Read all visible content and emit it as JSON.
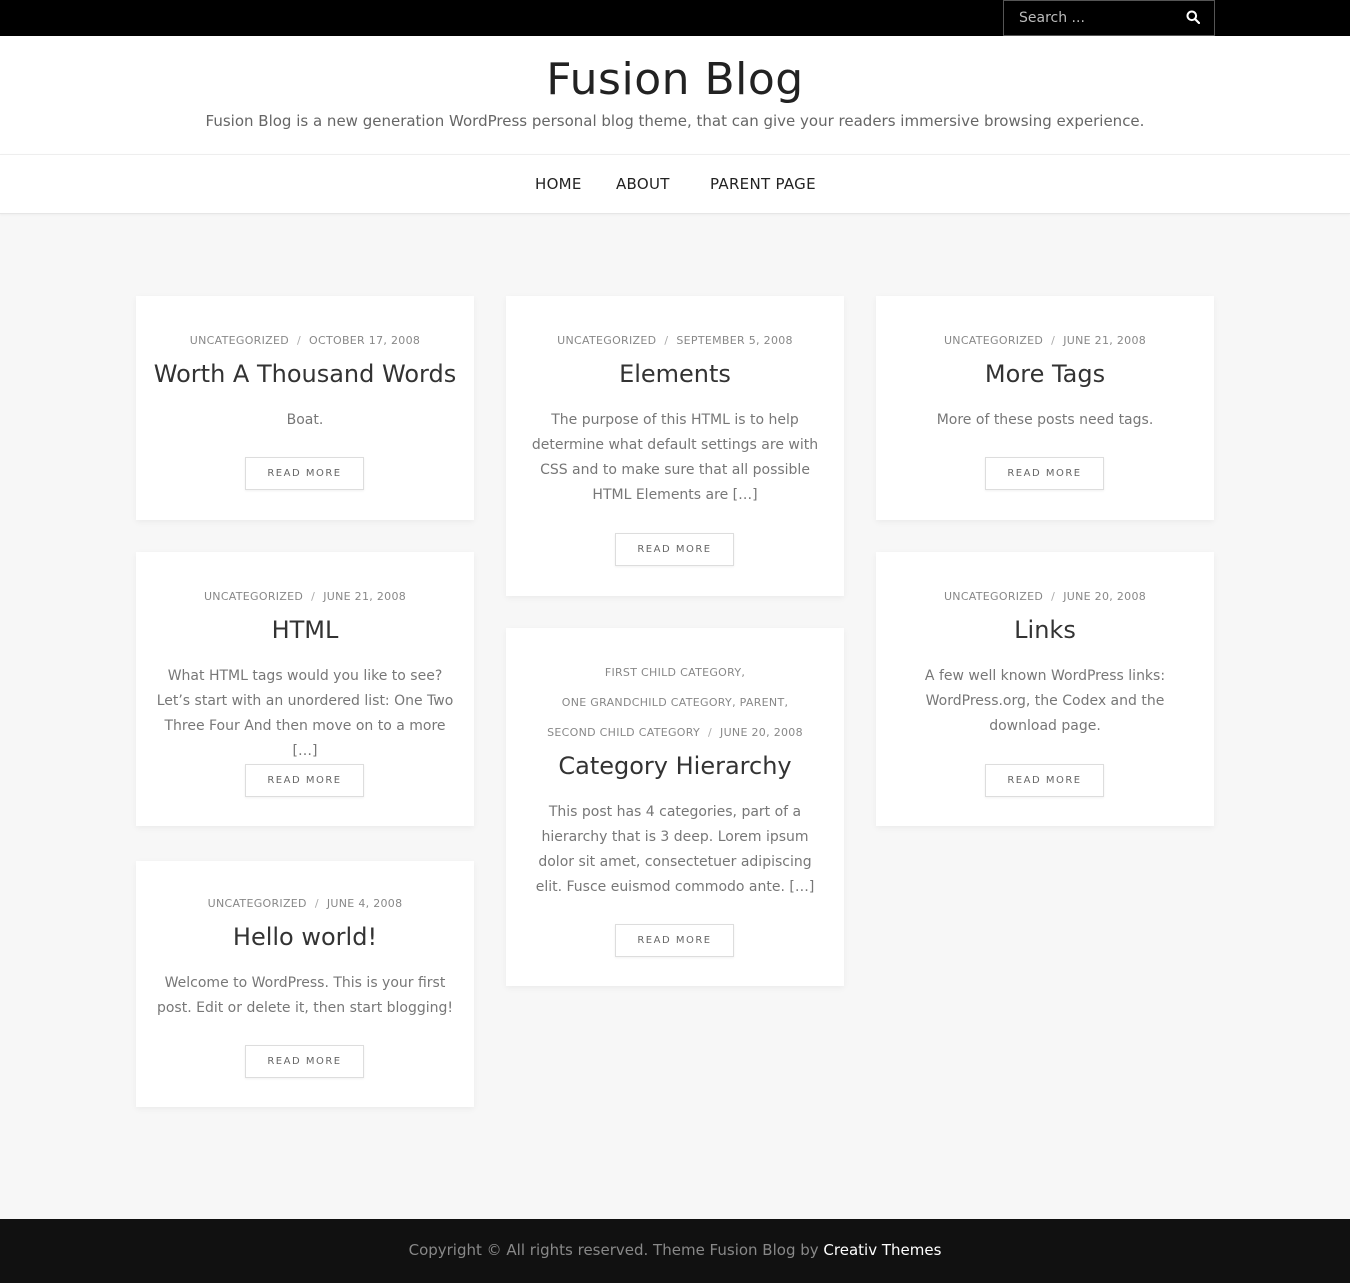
{
  "search": {
    "placeholder": "Search ..."
  },
  "site": {
    "title": "Fusion Blog",
    "description": "Fusion Blog is a new generation WordPress personal blog theme, that can give your readers immersive browsing experience."
  },
  "nav": {
    "items": [
      "HOME",
      "ABOUT",
      "PARENT PAGE"
    ]
  },
  "posts": [
    {
      "category": "UNCATEGORIZED",
      "date": "OCTOBER 17, 2008",
      "title": "Worth A Thousand Words",
      "excerpt": "Boat.",
      "read_more": "READ MORE"
    },
    {
      "category": "UNCATEGORIZED",
      "date": "SEPTEMBER 5, 2008",
      "title": "Elements",
      "excerpt": "The purpose of this HTML is to help determine what default settings are with CSS and to make sure that all possible HTML Elements are […]",
      "read_more": "READ MORE"
    },
    {
      "category": "UNCATEGORIZED",
      "date": "JUNE 21, 2008",
      "title": "More Tags",
      "excerpt": "More of these posts need tags.",
      "read_more": "READ MORE"
    },
    {
      "category": "UNCATEGORIZED",
      "date": "JUNE 21, 2008",
      "title": "HTML",
      "excerpt": "What HTML tags would you like to see? Let’s start with an unordered list: One Two Three Four And then move on to a more […]",
      "read_more": "READ MORE"
    },
    {
      "categories": [
        "FIRST CHILD CATEGORY,",
        "ONE GRANDCHILD CATEGORY,",
        "PARENT,",
        "SECOND CHILD CATEGORY"
      ],
      "date": "JUNE 20, 2008",
      "title": "Category Hierarchy",
      "excerpt": "This post has 4 categories, part of a hierarchy that is 3 deep. Lorem ipsum dolor sit amet, consectetuer adipiscing elit. Fusce euismod commodo ante. […]",
      "read_more": "READ MORE"
    },
    {
      "category": "UNCATEGORIZED",
      "date": "JUNE 20, 2008",
      "title": "Links",
      "excerpt": "A few well known WordPress links: WordPress.org, the Codex and the download page.",
      "read_more": "READ MORE"
    },
    {
      "category": "UNCATEGORIZED",
      "date": "JUNE 4, 2008",
      "title": "Hello world!",
      "excerpt": "Welcome to WordPress. This is your first post. Edit or delete it, then start blogging!",
      "read_more": "READ MORE"
    }
  ],
  "meta_separator": "/",
  "footer": {
    "text": "Copyright © All rights reserved. Theme Fusion Blog by",
    "link": "Creativ Themes"
  },
  "colors": {
    "topbar": "#000000",
    "background": "#f7f7f7",
    "card": "#ffffff",
    "footer": "#111111"
  },
  "icons": {
    "search": "search-icon"
  }
}
